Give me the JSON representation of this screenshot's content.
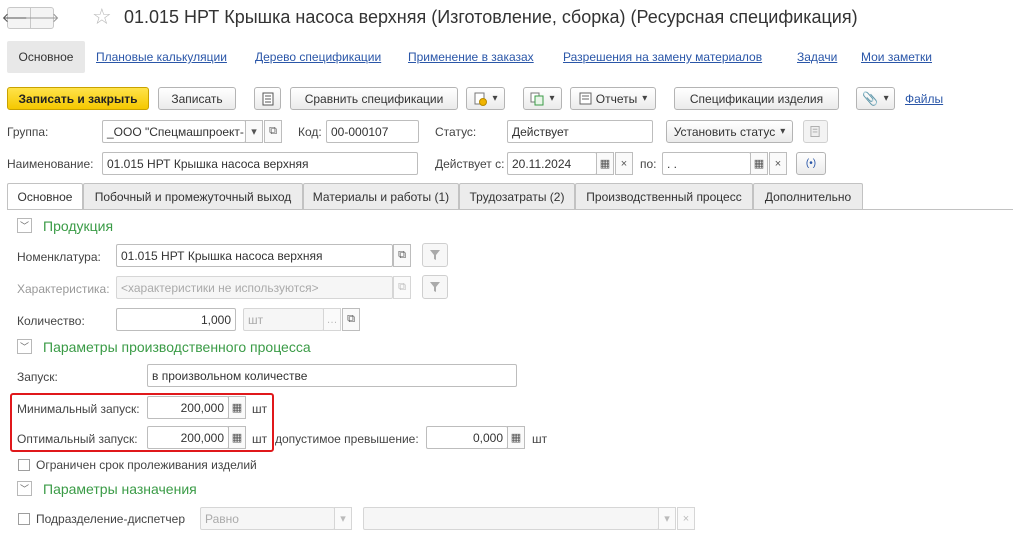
{
  "window": {
    "title": "01.015 НРТ Крышка насоса верхняя (Изготовление, сборка) (Ресурсная спецификация)"
  },
  "nav": {
    "active": "Основное",
    "links": [
      "Плановые калькуляции",
      "Дерево спецификации",
      "Применение в заказах",
      "Разрешения на замену материалов",
      "Задачи",
      "Мои заметки"
    ]
  },
  "toolbar": {
    "save_close": "Записать и закрыть",
    "save": "Записать",
    "compare": "Сравнить спецификации",
    "reports": "Отчеты",
    "item_specs": "Спецификации изделия",
    "files": "Файлы"
  },
  "header": {
    "group_label": "Группа:",
    "group_value": "_ООО \"Спецмашпроект-",
    "code_label": "Код:",
    "code_value": "00-000107",
    "status_label": "Статус:",
    "status_value": "Действует",
    "set_status": "Установить статус",
    "name_label": "Наименование:",
    "name_value": "01.015 НРТ Крышка насоса верхняя",
    "valid_from_label": "Действует с:",
    "valid_from_value": "20.11.2024",
    "valid_to_label": "по:",
    "valid_to_value": " .  ."
  },
  "tabs": [
    "Основное",
    "Побочный и промежуточный выход",
    "Материалы и работы (1)",
    "Трудозатраты (2)",
    "Производственный процесс",
    "Дополнительно"
  ],
  "product": {
    "group_title": "Продукция",
    "nomenclature_label": "Номенклатура:",
    "nomenclature_value": "01.015 НРТ Крышка насоса верхняя",
    "characteristic_label": "Характеристика:",
    "characteristic_placeholder": "<характеристики не используются>",
    "quantity_label": "Количество:",
    "quantity_value": "1,000",
    "unit": "шт"
  },
  "process": {
    "group_title": "Параметры производственного процесса",
    "launch_label": "Запуск:",
    "launch_value": "в произвольном количестве",
    "min_launch_label": "Минимальный запуск:",
    "min_launch_value": "200,000",
    "opt_launch_label": "Оптимальный запуск:",
    "opt_launch_value": "200,000",
    "unit": "шт",
    "excess_label": "допустимое превышение:",
    "excess_value": "0,000",
    "shelf_life_label": "Ограничен срок пролеживания изделий"
  },
  "assignment": {
    "group_title": "Параметры назначения",
    "dispatcher_label": "Подразделение-диспетчер",
    "condition_value": "Равно"
  },
  "colors": {
    "accent_green": "#3a9b46",
    "link_blue": "#2a56a8",
    "highlight_red": "#e0181b",
    "primary_yellow": "#f5c800"
  }
}
